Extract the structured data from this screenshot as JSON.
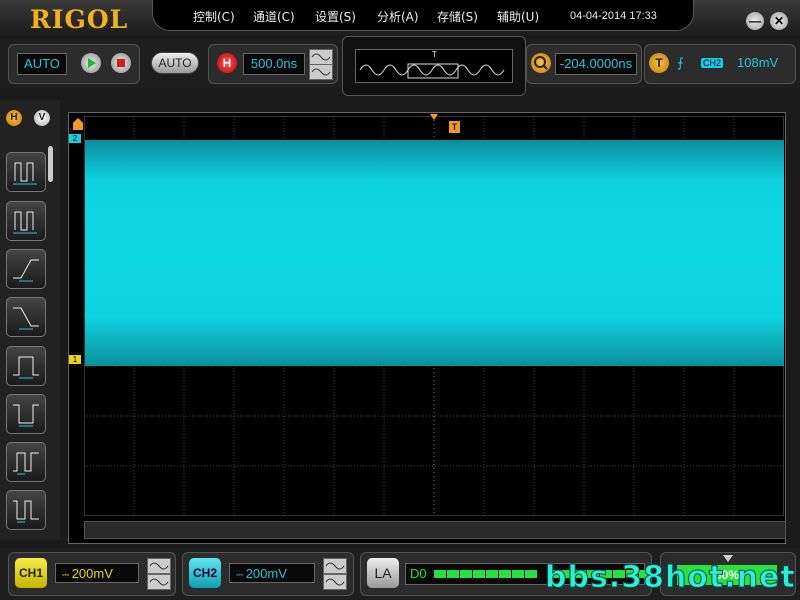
{
  "app": {
    "logo": "RIGOL"
  },
  "menu": [
    "控制(C)",
    "通道(C)",
    "设置(S)",
    "分析(A)",
    "存储(S)",
    "辅助(U)"
  ],
  "clock": "04-04-2014 17:33",
  "window": {
    "minimize_label": "—",
    "close_label": "✕"
  },
  "toolbar": {
    "mode": "AUTO",
    "auto_button": "AUTO",
    "horizontal_badge": "H",
    "timebase": "500.0ns",
    "trigger_mark": "T",
    "delay": "-204.0000ns",
    "trigger_badge": "T",
    "trigger_slope": "⨍",
    "trigger_source": "CH2",
    "trigger_level": "108mV"
  },
  "side": {
    "tab_h": "H",
    "tab_v": "V"
  },
  "markers": {
    "ch2": "2",
    "ch1": "1",
    "trig": "T"
  },
  "colors": {
    "ch1": "#e8d51b",
    "ch2": "#19cde0",
    "accent": "#f2b21f"
  },
  "bottom": {
    "ch1_label": "CH1",
    "ch1_scale": "200mV",
    "ch2_label": "CH2",
    "ch2_scale": "200mV",
    "la_label": "LA",
    "d0_label": "D0",
    "percent": "50%",
    "watermark": "bbs.38hot.net"
  }
}
